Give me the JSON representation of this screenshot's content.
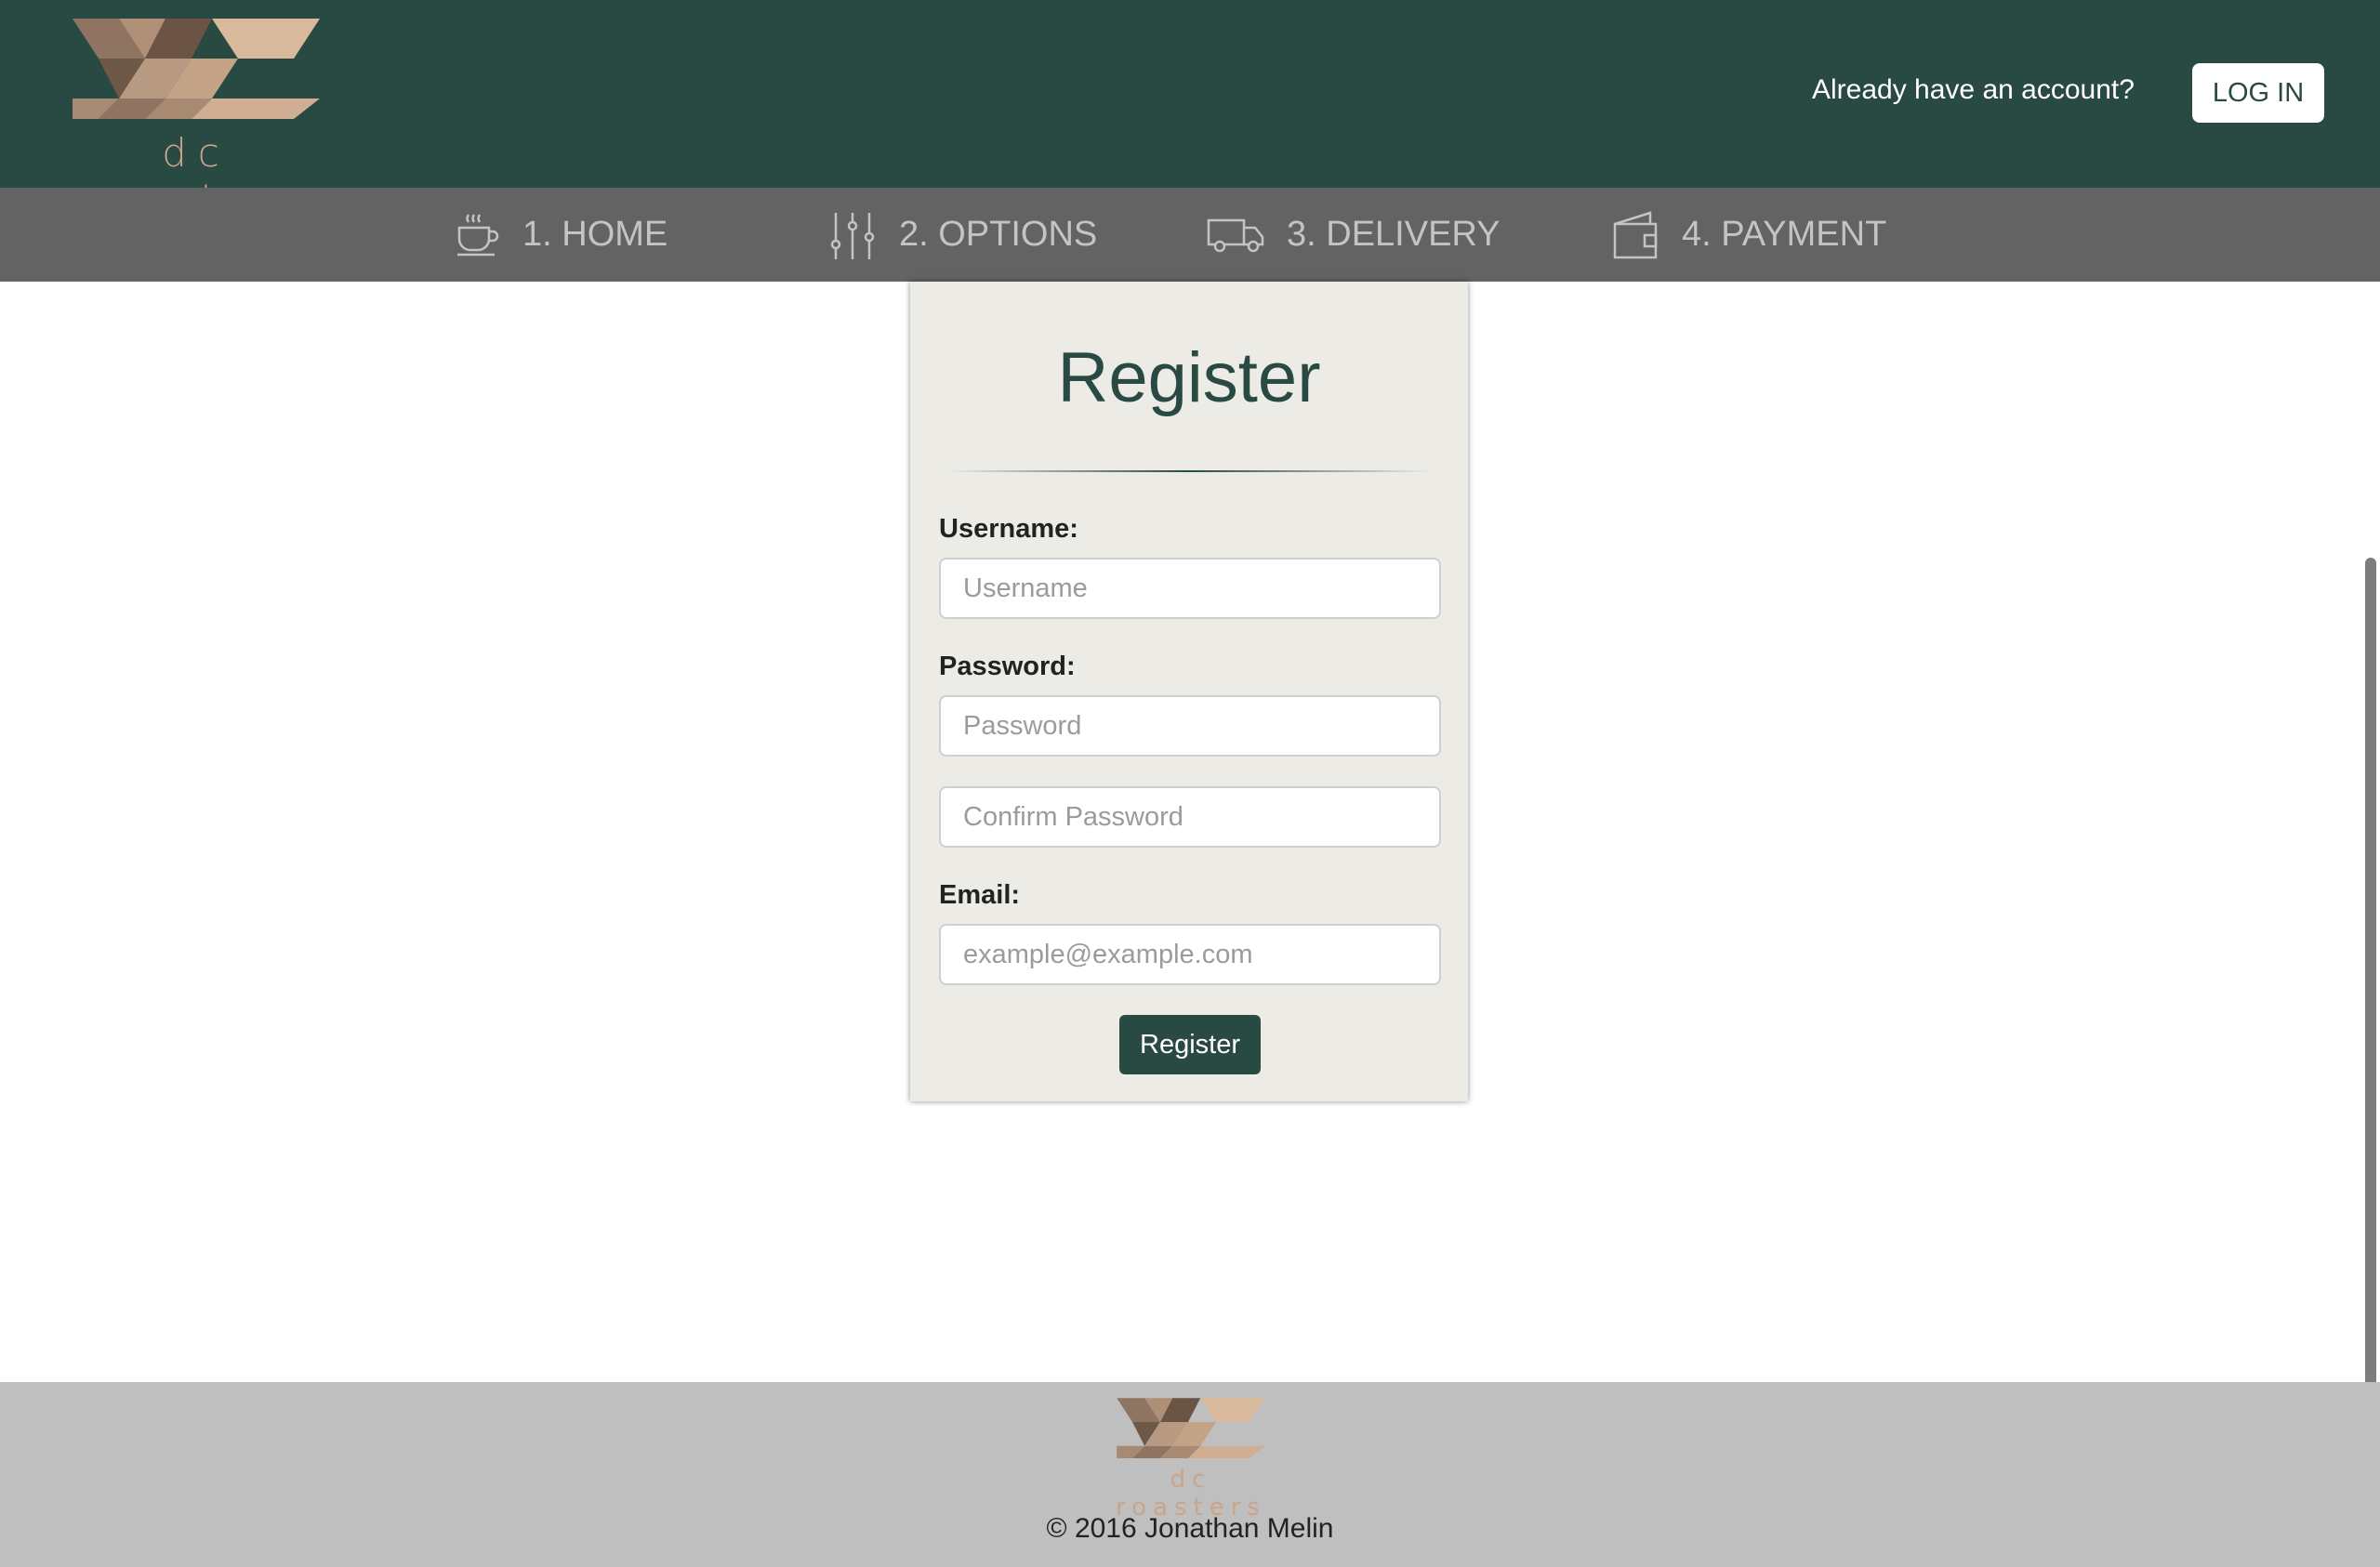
{
  "brand": {
    "name": "dc roasters",
    "primary_color": "#294943",
    "accent_color": "#c9a58a"
  },
  "header": {
    "account_prompt": "Already have an account?",
    "login_label": "LOG IN"
  },
  "nav": {
    "items": [
      {
        "label": "1. HOME",
        "icon": "coffee-cup-icon"
      },
      {
        "label": "2. OPTIONS",
        "icon": "sliders-icon"
      },
      {
        "label": "3. DELIVERY",
        "icon": "truck-icon"
      },
      {
        "label": "4. PAYMENT",
        "icon": "wallet-icon"
      }
    ]
  },
  "form": {
    "title": "Register",
    "username_label": "Username:",
    "username_placeholder": "Username",
    "password_label": "Password:",
    "password_placeholder": "Password",
    "confirm_placeholder": "Confirm Password",
    "email_label": "Email:",
    "email_placeholder": "example@example.com",
    "submit_label": "Register"
  },
  "footer": {
    "copyright": "© 2016 Jonathan Melin"
  }
}
